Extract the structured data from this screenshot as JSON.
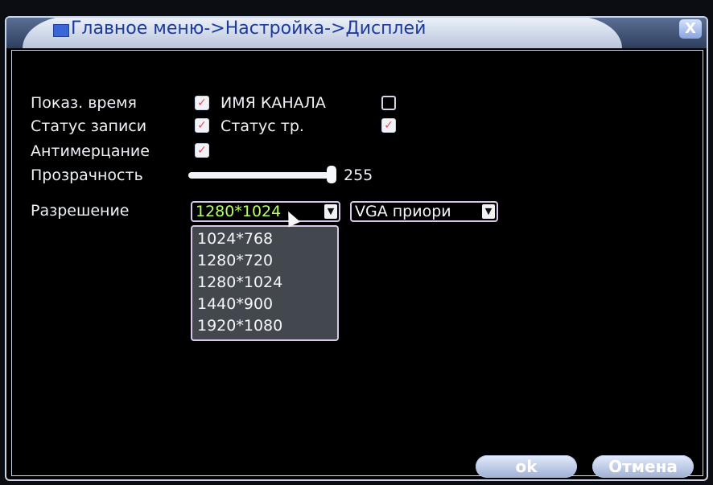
{
  "window": {
    "title": "Главное меню->Настройка->Дисплей",
    "close_label": "X"
  },
  "fields": {
    "show_time": "Показ. время",
    "channel_name": "ИМЯ КАНАЛА",
    "record_status": "Статус записи",
    "alarm_status": "Статус тр.",
    "deflicker": "Антимерцание",
    "transparency": "Прозрачность",
    "resolution": "Разрешение"
  },
  "checkbox_marks": {
    "checked": "✓"
  },
  "transparency": {
    "value": "255",
    "fraction": 1.0
  },
  "resolution_select": {
    "value": "1280*1024",
    "arrow": "▼",
    "options": [
      "1024*768",
      "1280*720",
      "1280*1024",
      "1440*900",
      "1920*1080"
    ]
  },
  "output_select": {
    "value": "VGA приори",
    "arrow": "▼"
  },
  "buttons": {
    "ok": "ok",
    "cancel": "Отмена"
  }
}
